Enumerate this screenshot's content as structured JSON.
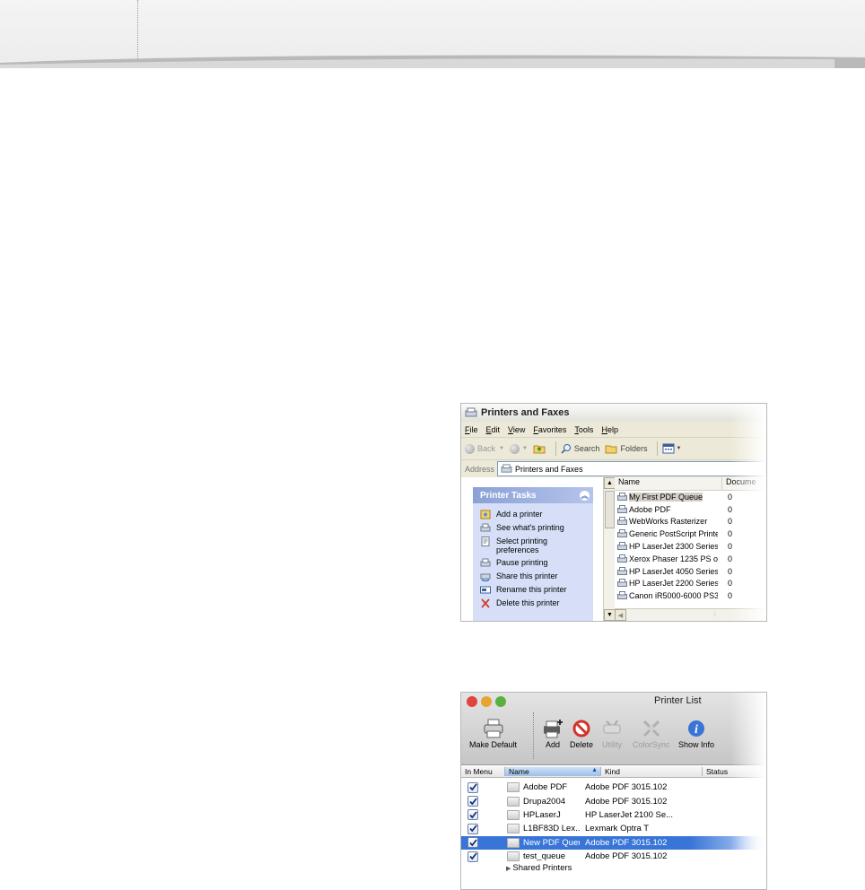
{
  "windows_window": {
    "title": "Printers and Faxes",
    "menu": [
      "File",
      "Edit",
      "View",
      "Favorites",
      "Tools",
      "Help"
    ],
    "toolbar": {
      "back": "Back",
      "search": "Search",
      "folders": "Folders"
    },
    "address": {
      "label": "Address",
      "value": "Printers and Faxes"
    },
    "tasks_panel": {
      "title": "Printer Tasks",
      "items": [
        "Add a printer",
        "See what's printing",
        "Select printing preferences",
        "Pause printing",
        "Share this printer",
        "Rename this printer",
        "Delete this printer"
      ]
    },
    "columns": {
      "name": "Name",
      "documents": "Docume"
    },
    "printers": [
      {
        "name": "My First PDF Queue",
        "docs": "0"
      },
      {
        "name": "Adobe PDF",
        "docs": "0"
      },
      {
        "name": "WebWorks Rasterizer",
        "docs": "0"
      },
      {
        "name": "Generic PostScript Printer",
        "docs": "0"
      },
      {
        "name": "HP LaserJet 2300 Series...",
        "docs": "0"
      },
      {
        "name": "Xerox Phaser 1235 PS o...",
        "docs": "0"
      },
      {
        "name": "HP LaserJet 4050 Series...",
        "docs": "0"
      },
      {
        "name": "HP LaserJet 2200 Series...",
        "docs": "0"
      },
      {
        "name": "Canon iR5000-6000 PS3...",
        "docs": "0"
      }
    ]
  },
  "mac_window": {
    "title": "Printer List",
    "toolbar": {
      "make_default": "Make Default",
      "add": "Add",
      "delete": "Delete",
      "utility": "Utility",
      "colorsync": "ColorSync",
      "show_info": "Show Info"
    },
    "columns": {
      "in_menu": "In Menu",
      "name": "Name",
      "kind": "Kind",
      "status": "Status"
    },
    "printers": [
      {
        "name": "Adobe PDF",
        "kind": "Adobe PDF 3015.102"
      },
      {
        "name": "Drupa2004",
        "kind": "Adobe PDF 3015.102"
      },
      {
        "name": "HPLaserJ",
        "kind": "HP LaserJet 2100 Se..."
      },
      {
        "name": "L1BF83D Lex...",
        "kind": "Lexmark Optra T"
      },
      {
        "name": "New PDF Queue",
        "kind": "Adobe PDF 3015.102"
      },
      {
        "name": "test_queue",
        "kind": "Adobe PDF 3015.102"
      }
    ],
    "shared_group": "Shared Printers",
    "colors": {
      "selection": "#3875d7",
      "close": "#e0443c",
      "minimize": "#e8a432",
      "zoom": "#5ab142"
    }
  }
}
